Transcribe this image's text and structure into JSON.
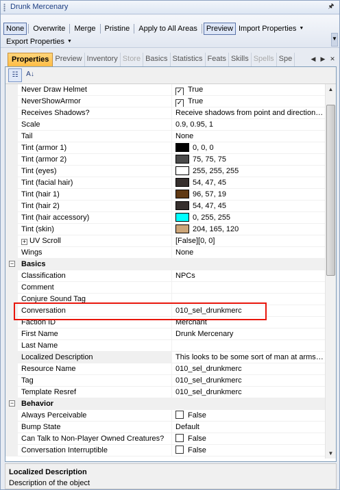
{
  "window": {
    "title": "Drunk Mercenary"
  },
  "toolbar": {
    "buttons": [
      "None",
      "Overwrite",
      "Merge",
      "Pristine",
      "Apply to All Areas",
      "Preview",
      "Import Properties",
      "Export Properties"
    ]
  },
  "tabs": [
    "Properties",
    "Preview",
    "Inventory",
    "Store",
    "Basics",
    "Statistics",
    "Feats",
    "Skills",
    "Spells",
    "Spe"
  ],
  "rows": [
    {
      "name": "Never Draw Helmet",
      "value": "True",
      "check": "checked"
    },
    {
      "name": "NeverShowArmor",
      "value": "True",
      "check": "checked"
    },
    {
      "name": "Receives Shadows?",
      "value": "Receive shadows from point and directiona..."
    },
    {
      "name": "Scale",
      "value": "0.9, 0.95, 1"
    },
    {
      "name": "Tail",
      "value": "None"
    },
    {
      "name": "Tint (armor 1)",
      "value": "0, 0, 0",
      "swatch": "#000000"
    },
    {
      "name": "Tint (armor 2)",
      "value": "75, 75, 75",
      "swatch": "#4b4b4b"
    },
    {
      "name": "Tint (eyes)",
      "value": "255, 255, 255",
      "swatch": "#ffffff"
    },
    {
      "name": "Tint (facial hair)",
      "value": "54, 47, 45",
      "swatch": "#362f2d"
    },
    {
      "name": "Tint (hair 1)",
      "value": "96, 57, 19",
      "swatch": "#603913"
    },
    {
      "name": "Tint (hair 2)",
      "value": "54, 47, 45",
      "swatch": "#362f2d"
    },
    {
      "name": "Tint (hair accessory)",
      "value": "0, 255, 255",
      "swatch": "#00ffff"
    },
    {
      "name": "Tint (skin)",
      "value": "204, 165, 120",
      "swatch": "#cca578"
    },
    {
      "name": "UV Scroll",
      "value": "[False][0, 0]",
      "expand": "+"
    },
    {
      "name": "Wings",
      "value": "None"
    },
    {
      "name": "Basics",
      "category": true
    },
    {
      "name": "Classification",
      "value": "NPCs"
    },
    {
      "name": "Comment",
      "value": ""
    },
    {
      "name": "Conjure Sound Tag",
      "value": ""
    },
    {
      "name": "Conversation",
      "value": "010_sel_drunkmerc"
    },
    {
      "name": "Faction ID",
      "value": "Merchant"
    },
    {
      "name": "First Name",
      "value": "Drunk Mercenary"
    },
    {
      "name": "Last Name",
      "value": ""
    },
    {
      "name": "Localized Description",
      "value": "This looks to be some sort of man at arms, ...",
      "selected": true
    },
    {
      "name": "Resource Name",
      "value": "010_sel_drunkmerc"
    },
    {
      "name": "Tag",
      "value": "010_sel_drunkmerc"
    },
    {
      "name": "Template Resref",
      "value": "010_sel_drunkmerc"
    },
    {
      "name": "Behavior",
      "category": true
    },
    {
      "name": "Always Perceivable",
      "value": "False",
      "check": "unchecked"
    },
    {
      "name": "Bump State",
      "value": "Default"
    },
    {
      "name": "Can Talk to Non-Player Owned Creatures?",
      "value": "False",
      "check": "unchecked"
    },
    {
      "name": "Conversation Interruptible",
      "value": "False",
      "check": "unchecked"
    }
  ],
  "description": {
    "title": "Localized Description",
    "text": "Description of the object"
  }
}
